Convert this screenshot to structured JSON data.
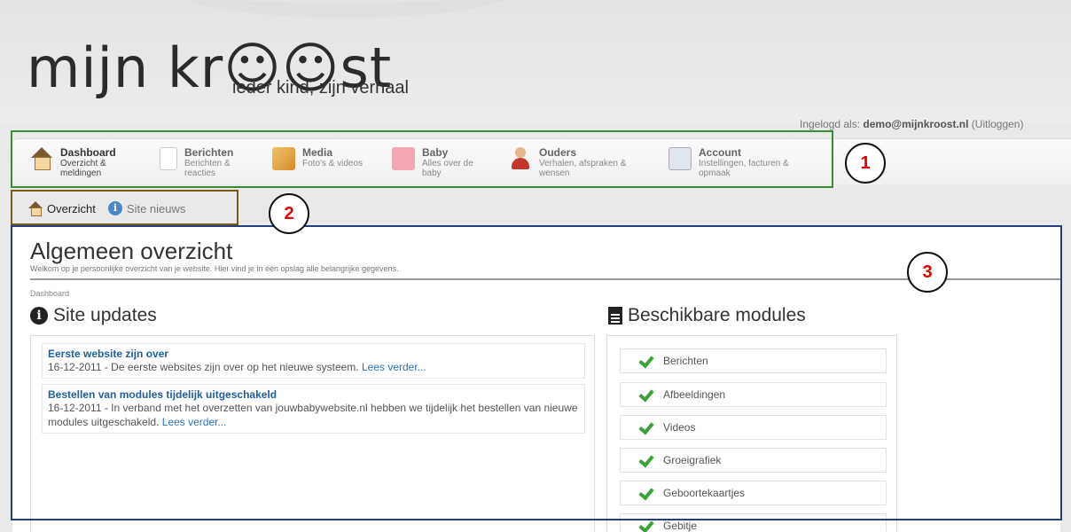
{
  "header": {
    "logo": "mijn kr☺☺st",
    "tagline": "ieder kind, zijn verhaal",
    "login_prefix": "Ingelogd als: ",
    "login_user": "demo@mijnkroost.nl",
    "logout_label": "(Uitloggen)"
  },
  "nav": {
    "items": [
      {
        "title": "Dashboard",
        "sub": "Overzicht & meldingen",
        "icon": "house-icon"
      },
      {
        "title": "Berichten",
        "sub": "Berichten & reacties",
        "icon": "document-icon"
      },
      {
        "title": "Media",
        "sub": "Foto's & videos",
        "icon": "media-icon"
      },
      {
        "title": "Baby",
        "sub": "Alles over de baby",
        "icon": "baby-icon"
      },
      {
        "title": "Ouders",
        "sub": "Verhalen, afspraken & wensen",
        "icon": "person-icon"
      },
      {
        "title": "Account",
        "sub": "Instellingen, facturen & opmaak",
        "icon": "account-card-icon"
      }
    ]
  },
  "subnav": {
    "items": [
      {
        "label": "Overzicht",
        "icon": "house-icon"
      },
      {
        "label": "Site nieuws",
        "icon": "info-icon"
      }
    ]
  },
  "annotations": [
    "1",
    "2",
    "3"
  ],
  "page": {
    "title": "Algemeen overzicht",
    "subtitle": "Welkom op je persoonlijke overzicht van je website. Hier vind je in één opslag alle belangrijke gegevens.",
    "breadcrumb": "Dashboard"
  },
  "updates": {
    "heading": "Site updates",
    "items": [
      {
        "title": "Eerste website zijn over",
        "date_text": "16-12-2011 - De eerste websites zijn over op het nieuwe systeem.",
        "link": "Lees verder..."
      },
      {
        "title": "Bestellen van modules tijdelijk uitgeschakeld",
        "date_text": "16-12-2011 - In verband met het overzetten van jouwbabywebsite.nl hebben we tijdelijk het bestellen van nieuwe modules uitgeschakeld.",
        "link": "Lees verder..."
      }
    ]
  },
  "modules": {
    "heading": "Beschikbare modules",
    "items": [
      "Berichten",
      "Afbeeldingen",
      "Videos",
      "Groeigrafiek",
      "Geboortekaartjes",
      "Gebitje"
    ]
  },
  "colors": {
    "link": "#2b72b8",
    "check": "#3ea038",
    "annotation_1": "#3a8a3a",
    "annotation_2": "#7a5a1a",
    "annotation_3": "#23407a",
    "annotation_number": "#e00000"
  }
}
